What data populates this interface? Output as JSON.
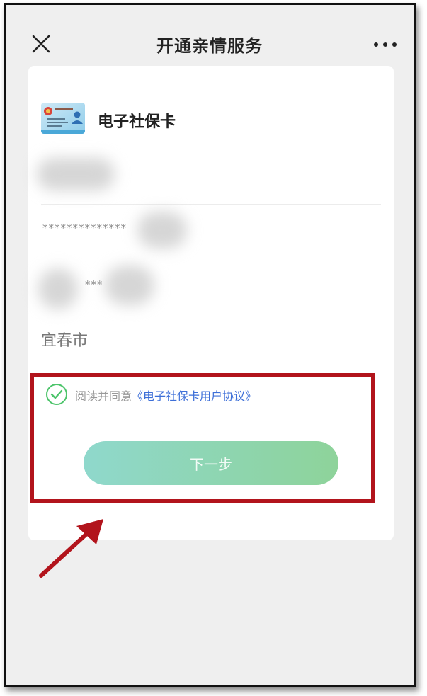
{
  "header": {
    "title": "开通亲情服务",
    "close_icon": "close-icon",
    "more_icon": "more-dots-icon"
  },
  "card": {
    "title": "电子社保卡",
    "card_icon": "social-security-card-icon",
    "fields": {
      "name_value": "",
      "id_value": "**************",
      "phone_value": "***",
      "city_value": "宜春市"
    }
  },
  "agreement": {
    "prefix": "阅读并同意",
    "link_text": "《电子社保卡用户协议》",
    "checked": true
  },
  "button": {
    "next_label": "下一步"
  },
  "annotation": {
    "highlight_color": "#b2141c",
    "arrow_color": "#b2141c"
  },
  "colors": {
    "button_gradient_start": "#8fd8cc",
    "button_gradient_end": "#8ed39a",
    "link_color": "#3d6fd8",
    "check_color": "#4cc46a"
  }
}
